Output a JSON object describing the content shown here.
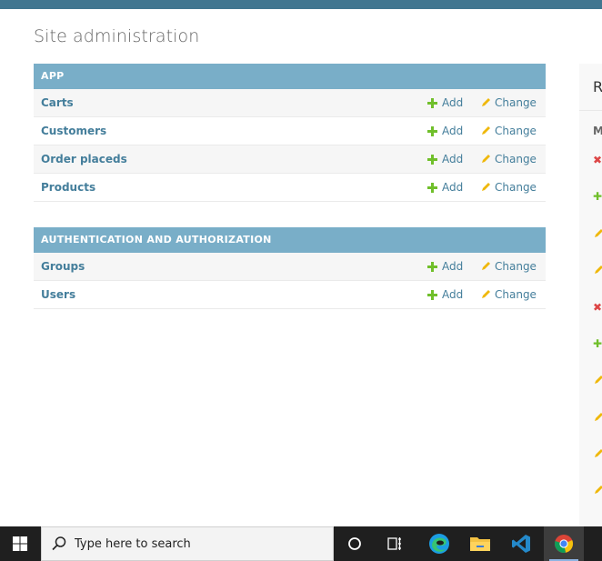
{
  "page": {
    "title": "Site administration"
  },
  "modules": [
    {
      "header": "APP",
      "rows": [
        {
          "label": "Carts",
          "add": "Add",
          "change": "Change"
        },
        {
          "label": "Customers",
          "add": "Add",
          "change": "Change"
        },
        {
          "label": "Order placeds",
          "add": "Add",
          "change": "Change"
        },
        {
          "label": "Products",
          "add": "Add",
          "change": "Change"
        }
      ]
    },
    {
      "header": "AUTHENTICATION AND AUTHORIZATION",
      "rows": [
        {
          "label": "Groups",
          "add": "Add",
          "change": "Change"
        },
        {
          "label": "Users",
          "add": "Add",
          "change": "Change"
        }
      ]
    }
  ],
  "sidebar": {
    "title": "R",
    "subtitle": "M",
    "icons": [
      "delete-icon",
      "add-icon",
      "change-icon",
      "change-icon",
      "delete-icon",
      "add-icon",
      "change-icon",
      "change-icon",
      "change-icon",
      "change-icon"
    ]
  },
  "taskbar": {
    "search_placeholder": "Type here to search",
    "apps": [
      "cortana-icon",
      "task-view-icon",
      "edge-icon",
      "file-explorer-icon",
      "vscode-icon",
      "chrome-icon"
    ]
  },
  "colors": {
    "header_bar": "#417690",
    "module_header": "#79aec8",
    "link": "#447e9b",
    "add_green": "#70bf2b",
    "change_yellow": "#efb80b",
    "delete_red": "#dd4646"
  }
}
